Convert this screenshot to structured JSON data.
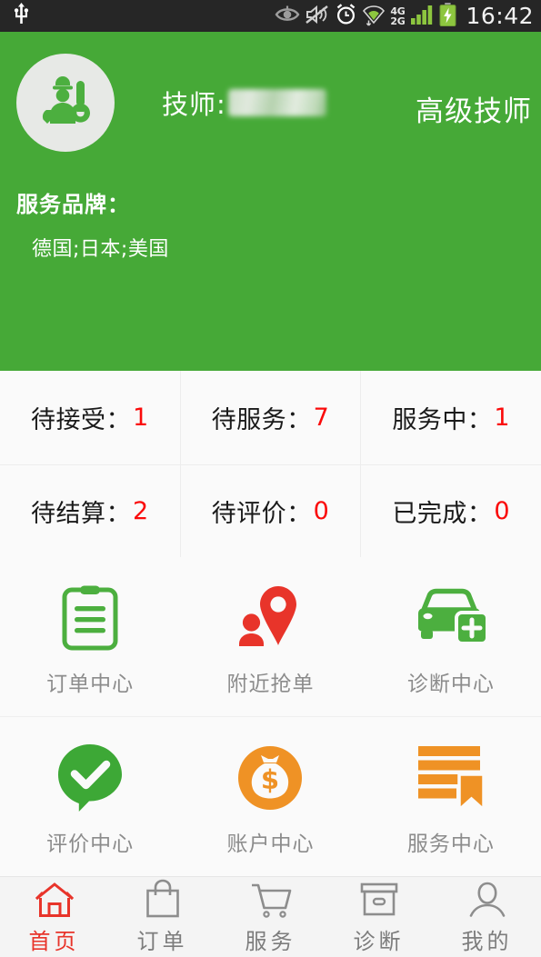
{
  "statusbar": {
    "time": "16:42",
    "net_top": "4G",
    "net_bottom": "2G",
    "icons": [
      "usb-icon",
      "eye-icon",
      "mute-icon",
      "alarm-icon",
      "wifi-icon",
      "signal-icon",
      "battery-charging-icon"
    ]
  },
  "header": {
    "avatar_icon": "technician-avatar-icon",
    "tech_label": "技师:",
    "tech_name_redacted": "",
    "tech_level": "高级技师",
    "brand_label": "服务品牌：",
    "brand_value": "德国;日本;美国",
    "bg_color": "#46a937"
  },
  "stats": {
    "num_color": "#fa0a0a",
    "rows": [
      [
        {
          "label": "待接受：",
          "value": "1"
        },
        {
          "label": "待服务：",
          "value": "7"
        },
        {
          "label": "服务中：",
          "value": "1"
        }
      ],
      [
        {
          "label": "待结算：",
          "value": "2"
        },
        {
          "label": "待评价：",
          "value": "0"
        },
        {
          "label": "已完成：",
          "value": "0"
        }
      ]
    ]
  },
  "grid": {
    "rows": [
      [
        {
          "label": "订单中心",
          "icon": "clipboard-icon",
          "color": "#4caf3f"
        },
        {
          "label": "附近抢单",
          "icon": "map-pin-person-icon",
          "color": "#e8342a"
        },
        {
          "label": "诊断中心",
          "icon": "car-medical-icon",
          "color": "#4caf3f"
        }
      ],
      [
        {
          "label": "评价中心",
          "icon": "check-bubble-icon",
          "color": "#3da836"
        },
        {
          "label": "账户中心",
          "icon": "money-bag-icon",
          "color": "#ef9225"
        },
        {
          "label": "服务中心",
          "icon": "list-bookmark-icon",
          "color": "#ef9225"
        }
      ]
    ]
  },
  "navbar": {
    "active_color": "#e8342a",
    "inactive_color": "#7d7d7d",
    "items": [
      {
        "label": "首页",
        "icon": "home-icon",
        "active": true
      },
      {
        "label": "订单",
        "icon": "shopping-bag-icon",
        "active": false
      },
      {
        "label": "服务",
        "icon": "shopping-cart-icon",
        "active": false
      },
      {
        "label": "诊断",
        "icon": "box-icon",
        "active": false
      },
      {
        "label": "我的",
        "icon": "person-icon",
        "active": false
      }
    ]
  }
}
